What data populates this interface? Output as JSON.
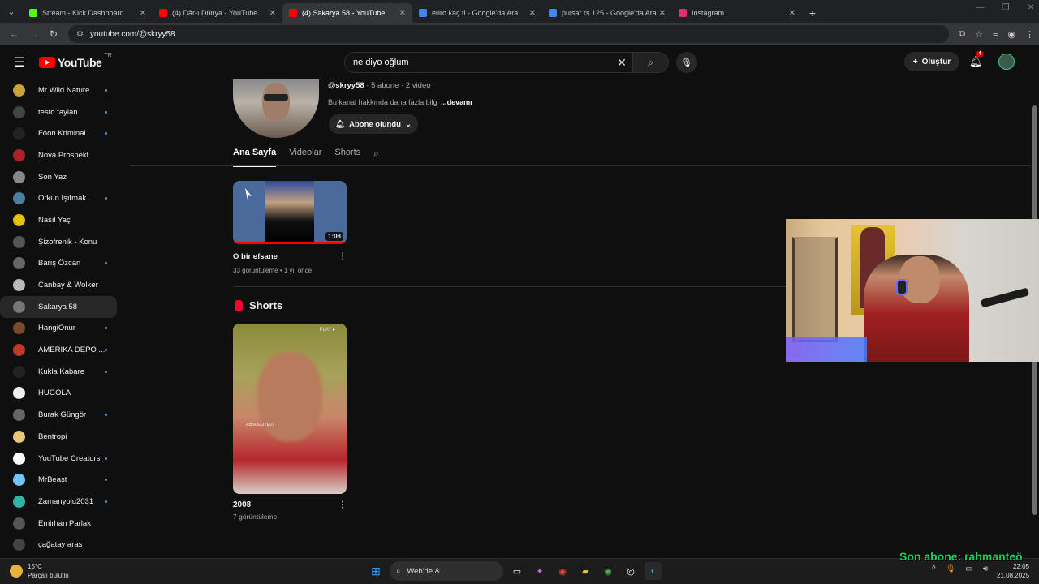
{
  "browser": {
    "tabs": [
      {
        "label": "Stream - Kick Dashboard",
        "icon": "kick-icon",
        "color": "#53fc18"
      },
      {
        "label": "(4) Dâr-ı Dünya - YouTube",
        "icon": "youtube-icon",
        "color": "#ff0000"
      },
      {
        "label": "(4) Sakarya 58 - YouTube",
        "icon": "youtube-icon",
        "color": "#ff0000",
        "active": true
      },
      {
        "label": "euro kaç tl - Google'da Ara",
        "icon": "google-icon",
        "color": "#4285f4"
      },
      {
        "label": "pulsar rs 125 - Google'da Ara",
        "icon": "google-icon",
        "color": "#4285f4"
      },
      {
        "label": "Instagram",
        "icon": "instagram-icon",
        "color": "#e1306c"
      }
    ],
    "url": "youtube.com/@skryy58"
  },
  "youtube": {
    "logo_text": "YouTube",
    "country": "TR",
    "search_value": "ne diyo oğlum",
    "create_label": "Oluştur",
    "notification_count": "4"
  },
  "sidebar": {
    "items": [
      {
        "label": "Mr Wild Nature",
        "dot": true,
        "color": "#c9a23a"
      },
      {
        "label": "testo taylan",
        "dot": true,
        "color": "#444"
      },
      {
        "label": "Foon Kriminal",
        "dot": true,
        "color": "#222"
      },
      {
        "label": "Nova Prospekt",
        "dot": false,
        "color": "#b0202a"
      },
      {
        "label": "Son Yaz",
        "dot": false,
        "color": "#888"
      },
      {
        "label": "Orkun Işıtmak",
        "dot": true,
        "color": "#4a7fa0"
      },
      {
        "label": "Nasıl Yaç",
        "dot": false,
        "color": "#e5c100"
      },
      {
        "label": "Şizofrenik - Konu",
        "dot": false,
        "color": "#555"
      },
      {
        "label": "Barış Özcan",
        "dot": true,
        "color": "#666"
      },
      {
        "label": "Canbay & Wolker",
        "dot": false,
        "color": "#bbb"
      },
      {
        "label": "Sakarya 58",
        "dot": false,
        "color": "#777",
        "active": true
      },
      {
        "label": "HangiOnur",
        "dot": true,
        "color": "#7a4a2a"
      },
      {
        "label": "AMERİKA DEPO ...",
        "dot": true,
        "color": "#c0392b"
      },
      {
        "label": "Kukla Kabare",
        "dot": true,
        "color": "#222"
      },
      {
        "label": "HUGOLA",
        "dot": false,
        "color": "#eee"
      },
      {
        "label": "Burak Güngör",
        "dot": true,
        "color": "#666"
      },
      {
        "label": "Bentropi",
        "dot": false,
        "color": "#e8c87a"
      },
      {
        "label": "YouTube Creators",
        "dot": true,
        "color": "#ffffff"
      },
      {
        "label": "MrBeast",
        "dot": true,
        "color": "#6ec6ff"
      },
      {
        "label": "Zamanyolu2031",
        "dot": true,
        "color": "#2fb5a8"
      },
      {
        "label": "Emirhan Parlak",
        "dot": false,
        "color": "#555"
      },
      {
        "label": "çağatay aras",
        "dot": false,
        "color": "#444"
      }
    ]
  },
  "channel": {
    "handle": "@skryy58",
    "meta": " · 5 abone · 2 video",
    "desc_prefix": "Bu kanal hakkında daha fazla bilgi ",
    "desc_more": "...devamı",
    "subscribe_label": "Abone olundu",
    "tabs": [
      "Ana Sayfa",
      "Videolar",
      "Shorts"
    ]
  },
  "video": {
    "title": "O bir efsane",
    "duration": "1:08",
    "meta": "33 görüntüleme • 1 yıl önce",
    "progress": 1.0
  },
  "shorts": {
    "heading": "Shorts",
    "item": {
      "title": "2008",
      "views": "7 görüntüleme",
      "play_badge": "PLAY ▸",
      "watermark": "ABSOLUTE07"
    }
  },
  "taskbar": {
    "temp": "15°C",
    "weather": "Parçalı bulutlu",
    "search_label": "Web'de &...",
    "time": "22:05",
    "date": "21.08.2025"
  },
  "overlay": {
    "last_sub": "Son abone: rahmanteö"
  }
}
